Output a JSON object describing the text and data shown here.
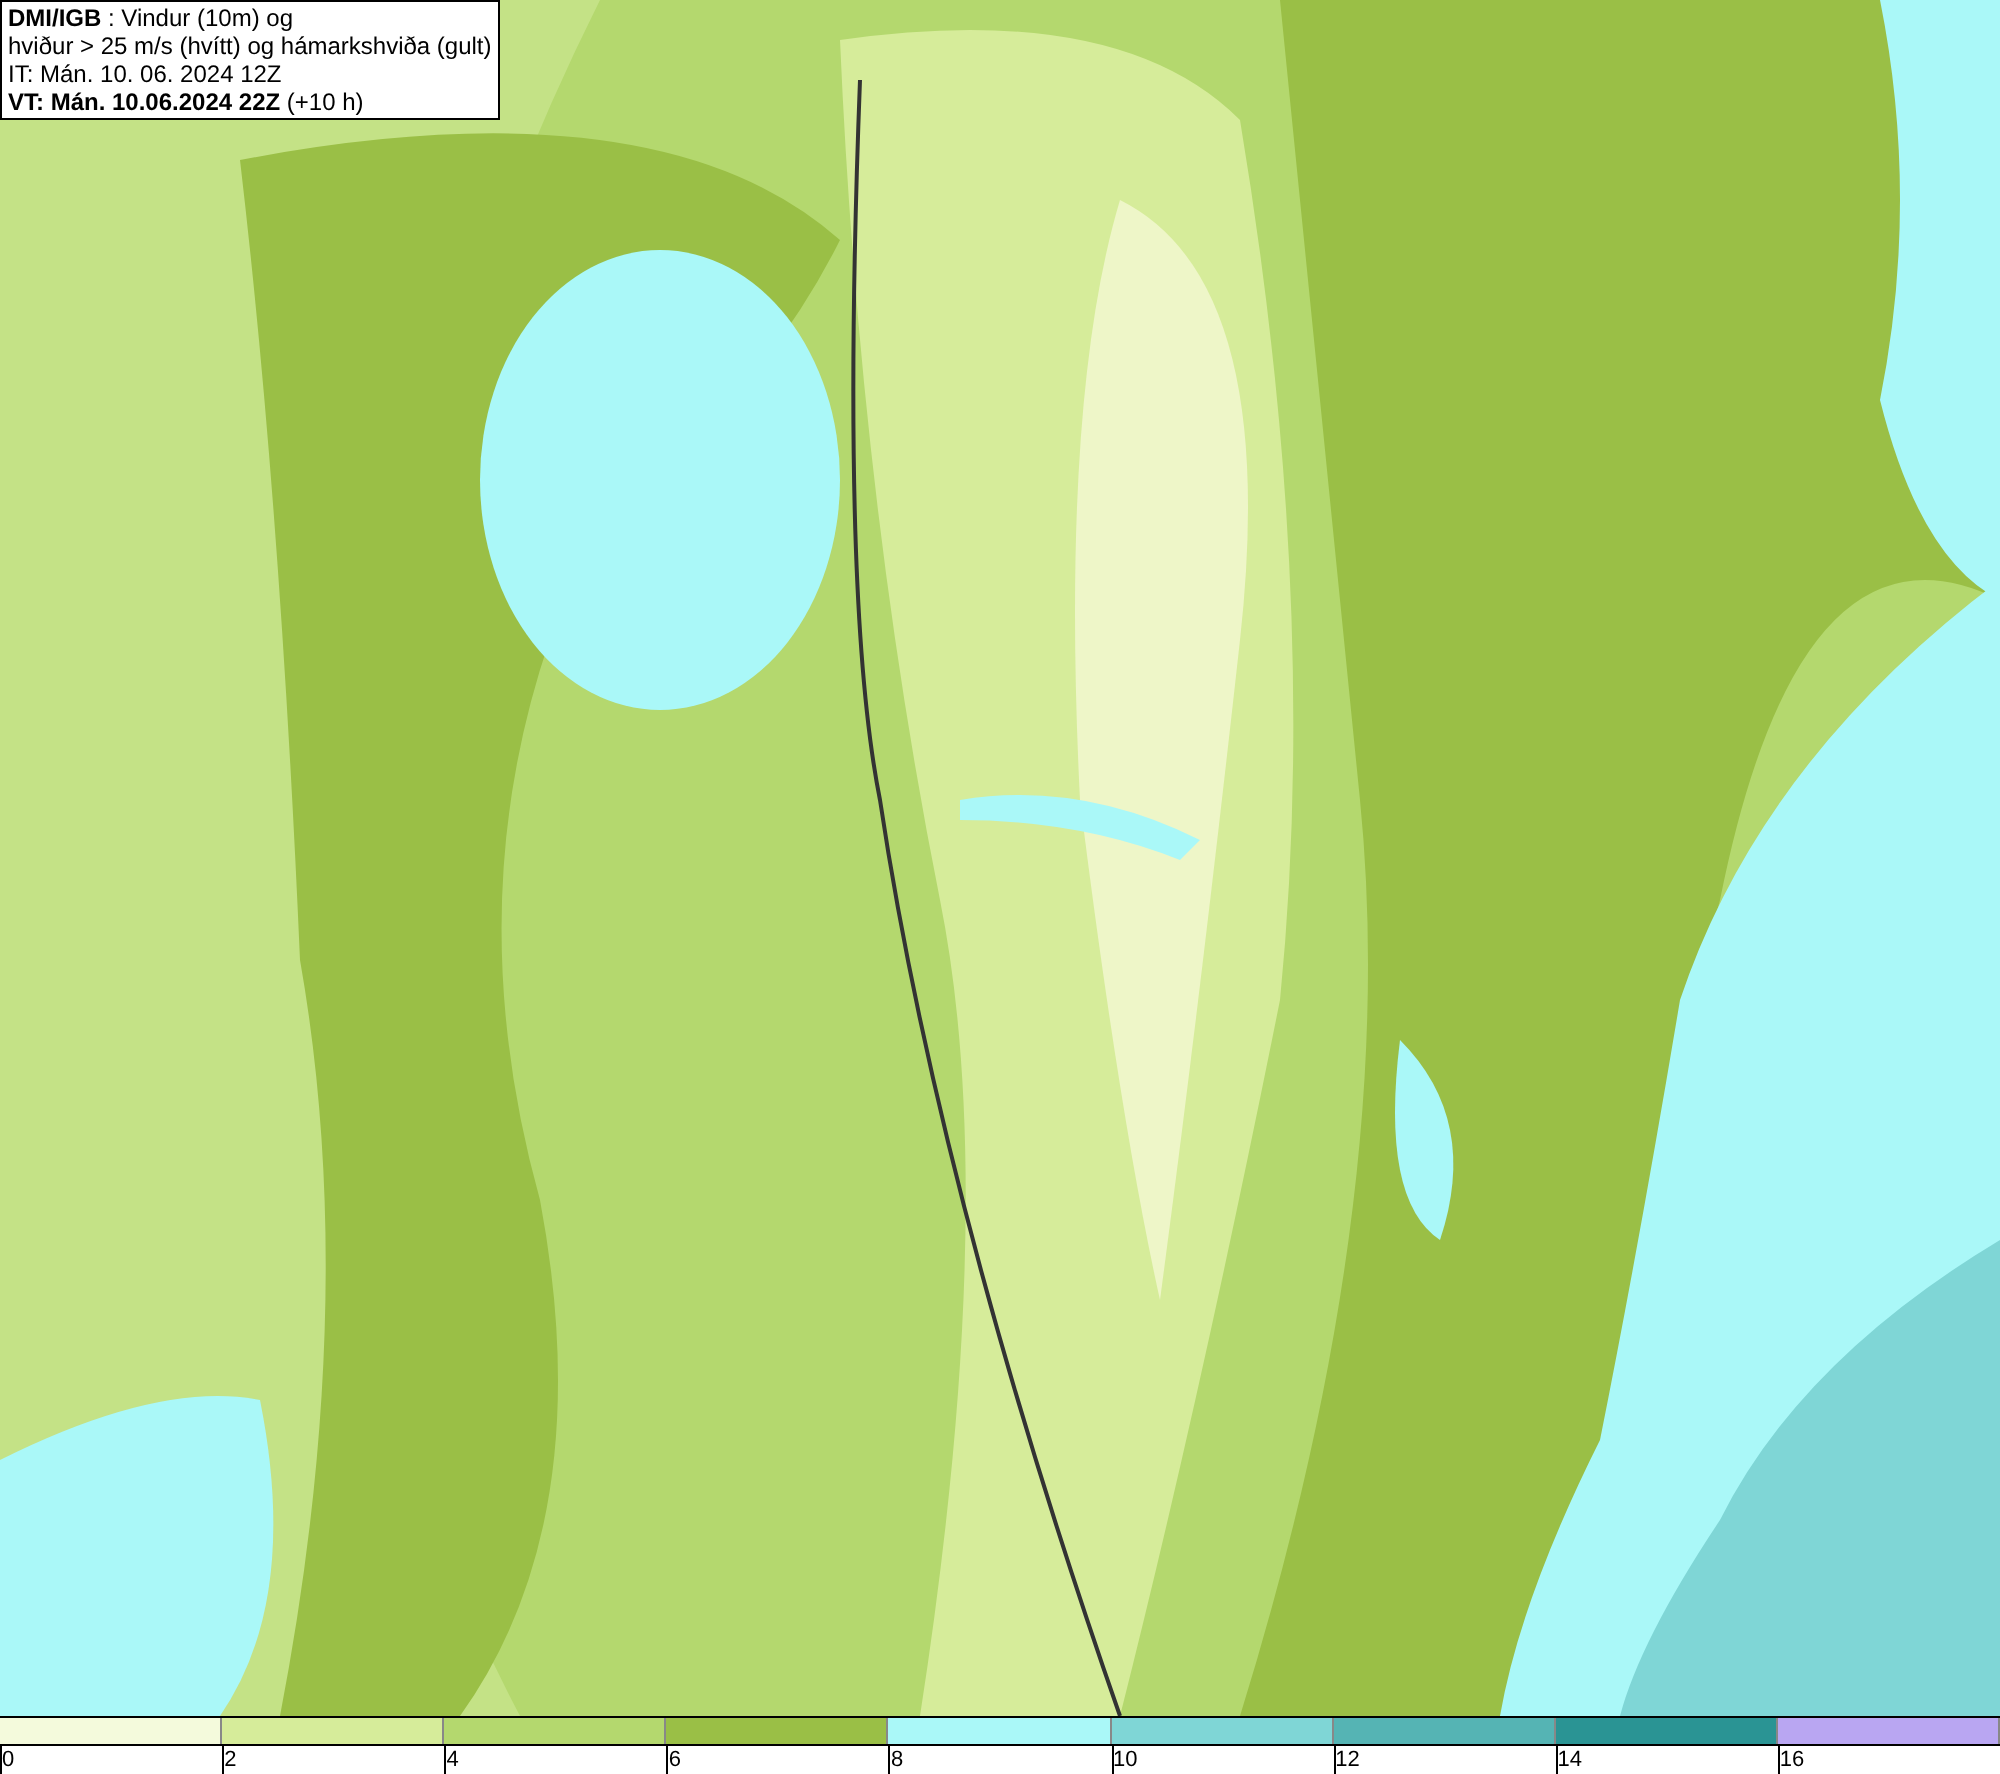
{
  "header": {
    "title": "**DMI/IGB** : Vindur (10m) og",
    "subtitle": "hviður > 25 m/s (hvítt) og hámarkshviða (gult)",
    "issue_time": "IT: Mán. 10. 06. 2024 12Z",
    "valid_time": "**VT: Mán. 10.06.2024 22Z** (+10 h)"
  },
  "legend": [
    {
      "label": "0",
      "color": "#f4fadc"
    },
    {
      "label": "2",
      "color": "#d6ec9a"
    },
    {
      "label": "4",
      "color": "#b4d86e"
    },
    {
      "label": "6",
      "color": "#9abf46"
    },
    {
      "label": "8",
      "color": "#aaf8f8"
    },
    {
      "label": "10",
      "color": "#7fd6d6"
    },
    {
      "label": "12",
      "color": "#55b4b4"
    },
    {
      "label": "14",
      "color": "#2a9494"
    },
    {
      "label": "16",
      "color": "#b9a6f2"
    }
  ]
}
